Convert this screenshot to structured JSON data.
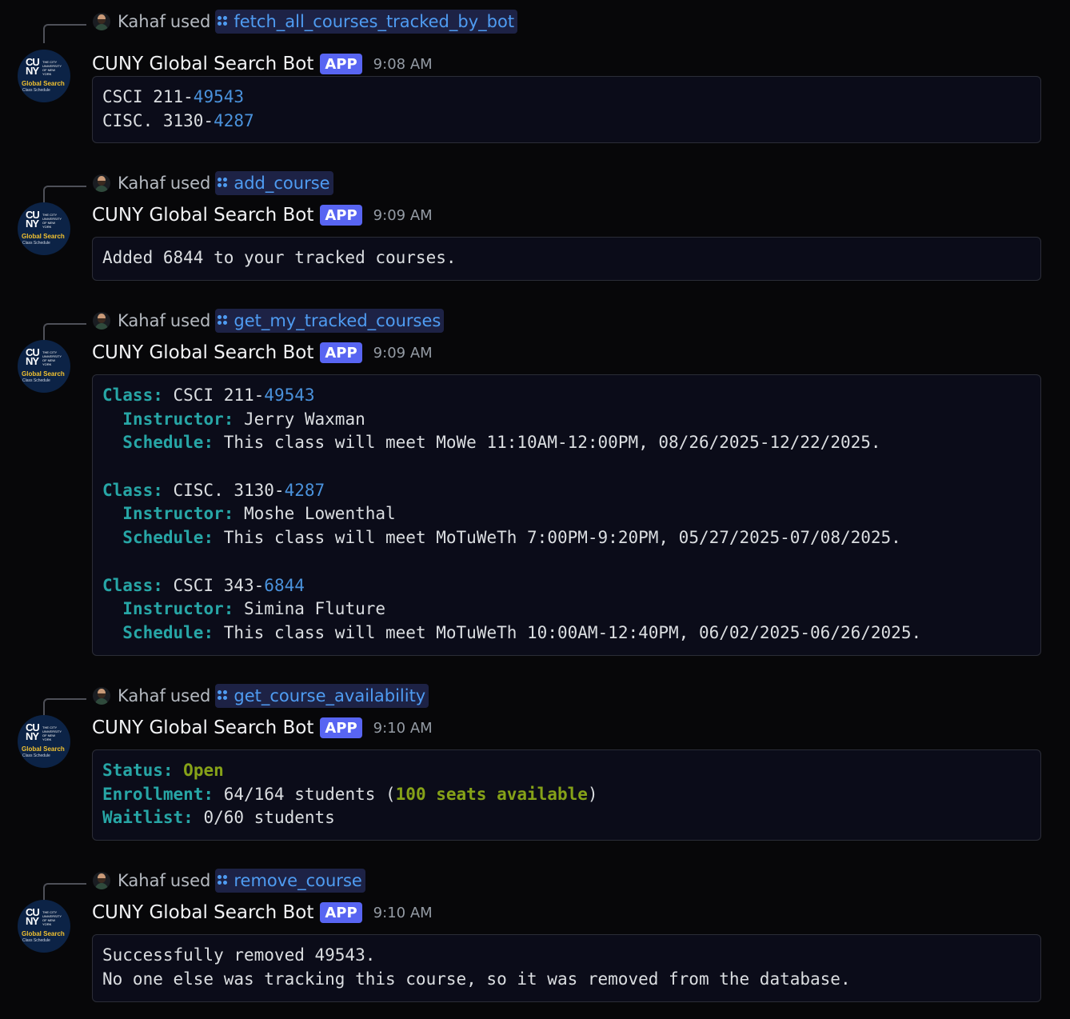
{
  "bot": {
    "name": "CUNY Global Search Bot",
    "badge": "APP",
    "avatar": {
      "logo_text": "CU NY",
      "university_text": "THE CITY UNIVERSITY OF NEW YORK",
      "title": "Global Search",
      "subtitle": "Class Schedule"
    }
  },
  "user": {
    "name": "Kahaf",
    "used_label": "used"
  },
  "colors": {
    "accent": "#5865f2",
    "link": "#4f9cf2",
    "keyword": "#27a6a6",
    "highlight": "#86a218"
  },
  "messages": [
    {
      "command": "fetch_all_courses_tracked_by_bot",
      "time": "9:08 AM",
      "lines": [
        [
          {
            "t": "CSCI 211-",
            "c": ""
          },
          {
            "t": "49543",
            "c": "num"
          }
        ],
        [
          {
            "t": "CISC. 3130-",
            "c": ""
          },
          {
            "t": "4287",
            "c": "num"
          }
        ]
      ]
    },
    {
      "command": "add_course",
      "time": "9:09 AM",
      "lines": [
        [
          {
            "t": "Added 6844 to your tracked courses.",
            "c": ""
          }
        ]
      ]
    },
    {
      "command": "get_my_tracked_courses",
      "time": "9:09 AM",
      "lines": [
        [
          {
            "t": "Class:",
            "c": "kw"
          },
          {
            "t": " CSCI 211-",
            "c": ""
          },
          {
            "t": "49543",
            "c": "num"
          }
        ],
        [
          {
            "t": "  ",
            "c": ""
          },
          {
            "t": "Instructor:",
            "c": "kw"
          },
          {
            "t": " Jerry Waxman",
            "c": ""
          }
        ],
        [
          {
            "t": "  ",
            "c": ""
          },
          {
            "t": "Schedule:",
            "c": "kw"
          },
          {
            "t": " This class will meet MoWe 11:10AM-12:00PM, 08/26/2025-12/22/2025.",
            "c": ""
          }
        ],
        [
          {
            "t": "",
            "c": ""
          }
        ],
        [
          {
            "t": "Class:",
            "c": "kw"
          },
          {
            "t": " CISC. 3130-",
            "c": ""
          },
          {
            "t": "4287",
            "c": "num"
          }
        ],
        [
          {
            "t": "  ",
            "c": ""
          },
          {
            "t": "Instructor:",
            "c": "kw"
          },
          {
            "t": " Moshe Lowenthal",
            "c": ""
          }
        ],
        [
          {
            "t": "  ",
            "c": ""
          },
          {
            "t": "Schedule:",
            "c": "kw"
          },
          {
            "t": " This class will meet MoTuWeTh 7:00PM-9:20PM, 05/27/2025-07/08/2025.",
            "c": ""
          }
        ],
        [
          {
            "t": "",
            "c": ""
          }
        ],
        [
          {
            "t": "Class:",
            "c": "kw"
          },
          {
            "t": " CSCI 343-",
            "c": ""
          },
          {
            "t": "6844",
            "c": "num"
          }
        ],
        [
          {
            "t": "  ",
            "c": ""
          },
          {
            "t": "Instructor:",
            "c": "kw"
          },
          {
            "t": " Simina Fluture",
            "c": ""
          }
        ],
        [
          {
            "t": "  ",
            "c": ""
          },
          {
            "t": "Schedule:",
            "c": "kw"
          },
          {
            "t": " This class will meet MoTuWeTh 10:00AM-12:40PM, 06/02/2025-06/26/2025.",
            "c": ""
          }
        ]
      ]
    },
    {
      "command": "get_course_availability",
      "time": "9:10 AM",
      "lines": [
        [
          {
            "t": "Status:",
            "c": "kw"
          },
          {
            "t": " ",
            "c": ""
          },
          {
            "t": "Open",
            "c": "grn"
          }
        ],
        [
          {
            "t": "Enrollment:",
            "c": "kw"
          },
          {
            "t": " 64/164 students (",
            "c": ""
          },
          {
            "t": "100 seats available",
            "c": "grn"
          },
          {
            "t": ")",
            "c": ""
          }
        ],
        [
          {
            "t": "Waitlist:",
            "c": "kw"
          },
          {
            "t": " 0/60 students",
            "c": ""
          }
        ]
      ]
    },
    {
      "command": "remove_course",
      "time": "9:10 AM",
      "lines": [
        [
          {
            "t": "Successfully removed 49543.",
            "c": ""
          }
        ],
        [
          {
            "t": "No one else was tracking this course, so it was removed from the database.",
            "c": ""
          }
        ]
      ]
    }
  ]
}
